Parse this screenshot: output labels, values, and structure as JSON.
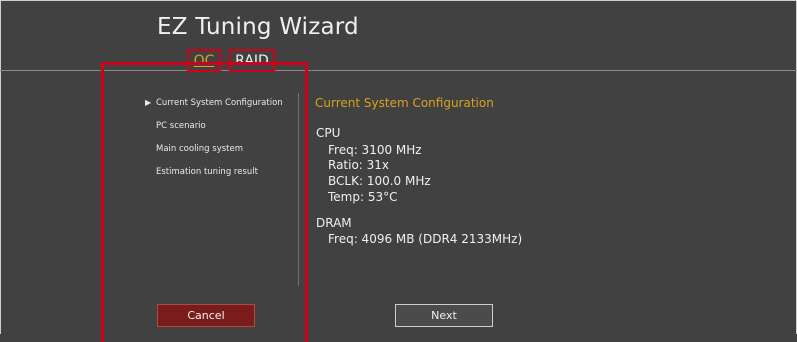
{
  "window": {
    "title": "EZ Tuning Wizard"
  },
  "tabs": [
    {
      "label": "OC",
      "active": true
    },
    {
      "label": "RAID",
      "active": false
    }
  ],
  "steps": [
    {
      "label": "Current System Configuration",
      "current": true
    },
    {
      "label": "PC scenario",
      "current": false
    },
    {
      "label": "Main cooling system",
      "current": false
    },
    {
      "label": "Estimation tuning result",
      "current": false
    }
  ],
  "main": {
    "section_title": "Current System Configuration",
    "cpu": {
      "heading": "CPU",
      "freq": "Freq: 3100 MHz",
      "ratio": "Ratio: 31x",
      "bclk": "BCLK: 100.0 MHz",
      "temp": "Temp: 53°C"
    },
    "dram": {
      "heading": "DRAM",
      "freq": "Freq: 4096 MB (DDR4 2133MHz)"
    }
  },
  "buttons": {
    "cancel": "Cancel",
    "next": "Next"
  },
  "colors": {
    "accent": "#d9a21b",
    "highlight": "#d0021b",
    "cancel_bg": "#7a1c1c"
  },
  "icons": {
    "current_step": "triangle-right-icon"
  }
}
